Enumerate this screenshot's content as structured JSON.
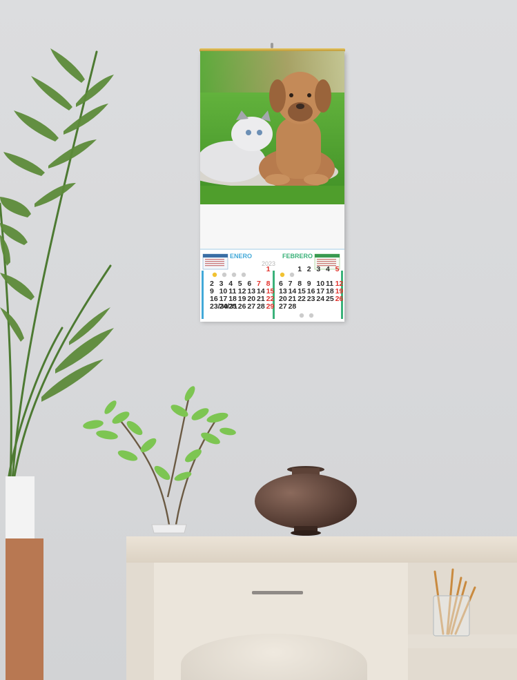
{
  "scene": {
    "description_colors": {
      "wall": "#d9dadc",
      "sideboard": "#e6ded2",
      "vase": "#5a4036"
    }
  },
  "calendar": {
    "year": "2023",
    "months": [
      {
        "name": "ENERO",
        "color": "#43a9d8",
        "rows": [
          [
            "",
            "",
            "",
            "",
            "",
            "",
            "1"
          ],
          [
            "2",
            "3",
            "4",
            "5",
            "6",
            "7",
            "8"
          ],
          [
            "9",
            "10",
            "11",
            "12",
            "13",
            "14",
            "15"
          ],
          [
            "16",
            "17",
            "18",
            "19",
            "20",
            "21",
            "22"
          ],
          [
            "23/30",
            "24/31",
            "25",
            "26",
            "27",
            "28",
            "29"
          ]
        ]
      },
      {
        "name": "FEBRERO",
        "color": "#3bb27a",
        "rows": [
          [
            "",
            "",
            "1",
            "2",
            "3",
            "4",
            "5"
          ],
          [
            "6",
            "7",
            "8",
            "9",
            "10",
            "11",
            "12"
          ],
          [
            "13",
            "14",
            "15",
            "16",
            "17",
            "18",
            "19"
          ],
          [
            "20",
            "21",
            "22",
            "23",
            "24",
            "25",
            "26"
          ],
          [
            "27",
            "28",
            "",
            "",
            "",
            "",
            ""
          ]
        ]
      }
    ],
    "holiday_color": "#e2312b",
    "default_color": "#2b2b2b"
  }
}
